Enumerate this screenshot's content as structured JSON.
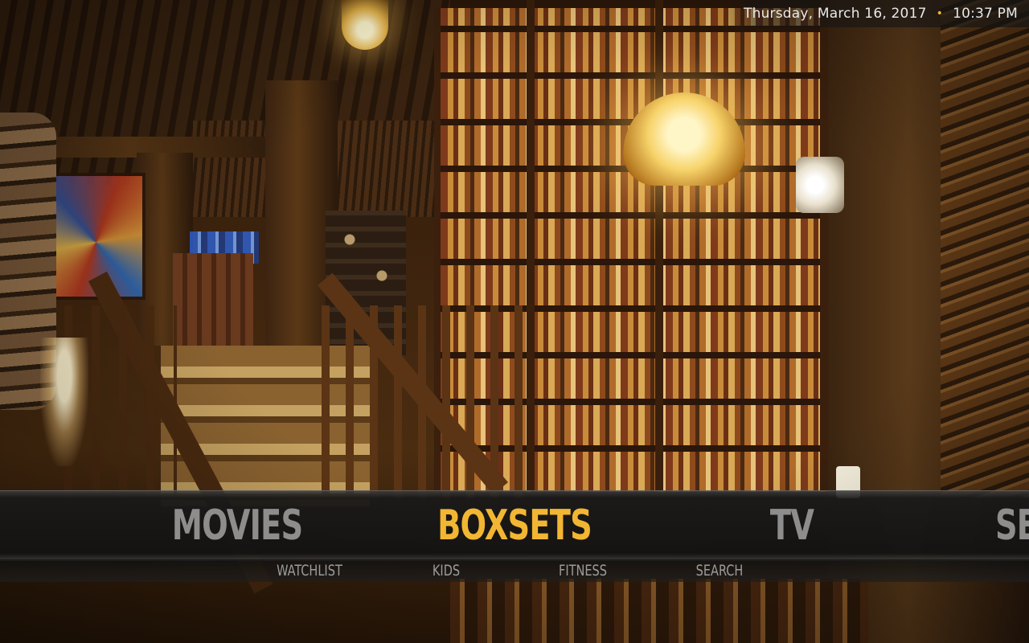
{
  "clock": {
    "date": "Thursday, March 16, 2017",
    "separator": "•",
    "time": "10:37 PM"
  },
  "home_menu": {
    "items": [
      {
        "label": "MOVIES",
        "active": false
      },
      {
        "label": "BOXSETS",
        "active": true
      },
      {
        "label": "TV",
        "active": false
      },
      {
        "label": "SE",
        "active": false
      }
    ],
    "submenu": [
      {
        "label": "WATCHLIST"
      },
      {
        "label": "KIDS"
      },
      {
        "label": "FITNESS"
      },
      {
        "label": "SEARCH"
      }
    ]
  },
  "colors": {
    "accent": "#f2b632",
    "inactive_text": "#8d8d8d",
    "clock_text": "#e8e8e8"
  }
}
